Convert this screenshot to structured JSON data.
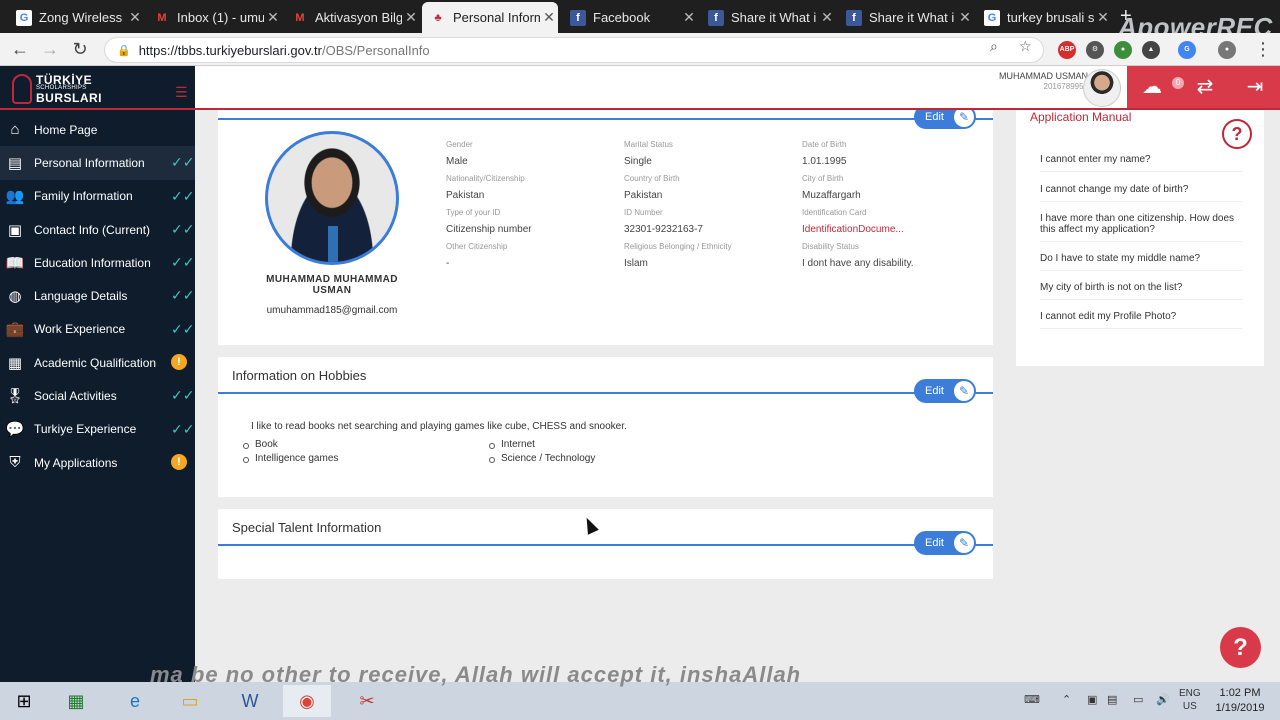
{
  "browser": {
    "tabs": [
      {
        "title": "Zong Wireless",
        "icon": "google-icon",
        "active": false
      },
      {
        "title": "Inbox (1) - umu",
        "icon": "gmail-icon",
        "active": false
      },
      {
        "title": "Aktivasyon Bilg",
        "icon": "gmail-icon",
        "active": false
      },
      {
        "title": "Personal Inform",
        "icon": "tulip-icon",
        "active": true
      },
      {
        "title": "Facebook",
        "icon": "facebook-icon",
        "active": false
      },
      {
        "title": "Share it What i",
        "icon": "facebook-icon",
        "active": false
      },
      {
        "title": "Share it What i",
        "icon": "facebook-icon",
        "active": false
      },
      {
        "title": "turkey brusali s",
        "icon": "google-icon",
        "active": false
      }
    ],
    "url_host": "https://tbbs.turkiyeburslari.gov.tr",
    "url_path": "/OBS/PersonalInfo",
    "recorder_watermark": "ApowerREC"
  },
  "logo": {
    "line1": "TÜRKİYE",
    "line2": "SCHOLARSHIPS",
    "line3": "BURSLARI"
  },
  "sidebar": {
    "items": [
      {
        "label": "Home Page",
        "icon": "home-icon",
        "status": ""
      },
      {
        "label": "Personal Information",
        "icon": "id-card-icon",
        "status": "done"
      },
      {
        "label": "Family Information",
        "icon": "family-icon",
        "status": "done"
      },
      {
        "label": "Contact Info (Current)",
        "icon": "contact-card-icon",
        "status": "done"
      },
      {
        "label": "Education Information",
        "icon": "book-icon",
        "status": "done"
      },
      {
        "label": "Language Details",
        "icon": "globe-icon",
        "status": "done"
      },
      {
        "label": "Work Experience",
        "icon": "briefcase-icon",
        "status": "done"
      },
      {
        "label": "Academic Qualification",
        "icon": "certificate-icon",
        "status": "warn"
      },
      {
        "label": "Social Activities",
        "icon": "medal-icon",
        "status": "done"
      },
      {
        "label": "Turkiye Experience",
        "icon": "chat-icon",
        "status": "done"
      },
      {
        "label": "My Applications",
        "icon": "shield-icon",
        "status": "warn"
      }
    ]
  },
  "header": {
    "user_name": "MUHAMMAD USMAN",
    "user_id": "2016789951",
    "notification_count": "0"
  },
  "profile": {
    "name": "MUHAMMAD MUHAMMAD USMAN",
    "email": "umuhammad185@gmail.com",
    "edit_label": "Edit",
    "fields": [
      {
        "key": "Gender",
        "value": "Male"
      },
      {
        "key": "Marital Status",
        "value": "Single"
      },
      {
        "key": "Date of Birth",
        "value": "1.01.1995"
      },
      {
        "key": "Nationality/Citizenship",
        "value": "Pakistan"
      },
      {
        "key": "Country of Birth",
        "value": "Pakistan"
      },
      {
        "key": "City of Birth",
        "value": "Muzaffargarh"
      },
      {
        "key": "Type of your ID",
        "value": "Citizenship number"
      },
      {
        "key": "ID Number",
        "value": "32301-9232163-7"
      },
      {
        "key": "Identification Card",
        "value": "IdentificationDocume..."
      },
      {
        "key": "Other Citizenship",
        "value": "-"
      },
      {
        "key": "Religious Belonging / Ethnicity",
        "value": "Islam"
      },
      {
        "key": "Disability Status",
        "value": "I dont have any disability."
      }
    ]
  },
  "hobbies": {
    "title": "Information on Hobbies",
    "edit_label": "Edit",
    "description": "I like to read books net searching and playing games like cube, CHESS and snooker.",
    "col1": [
      "Book",
      "Intelligence games"
    ],
    "col2": [
      "Internet",
      "Science / Technology"
    ]
  },
  "talent": {
    "title": "Special Talent Information",
    "edit_label": "Edit"
  },
  "manual": {
    "title": "Application Manual",
    "questions": [
      "I cannot enter my name?",
      "I cannot change my date of birth?",
      "I have more than one citizenship. How does this affect my application?",
      "Do I have to state my middle name?",
      "My city of birth is not on the list?",
      "I cannot edit my Profile Photo?"
    ]
  },
  "overlay_text": "ma be no other to receive, Allah will accept it, inshaAllah",
  "taskbar": {
    "lang": "ENG",
    "region": "US",
    "time": "1:02 PM",
    "date": "1/19/2019"
  },
  "colors": {
    "brand_red": "#c0283a",
    "accent_blue": "#3b7dd8",
    "sidebar_bg": "#0f1c2c",
    "ok_teal": "#3ec6c0",
    "warn_orange": "#f5a623"
  }
}
